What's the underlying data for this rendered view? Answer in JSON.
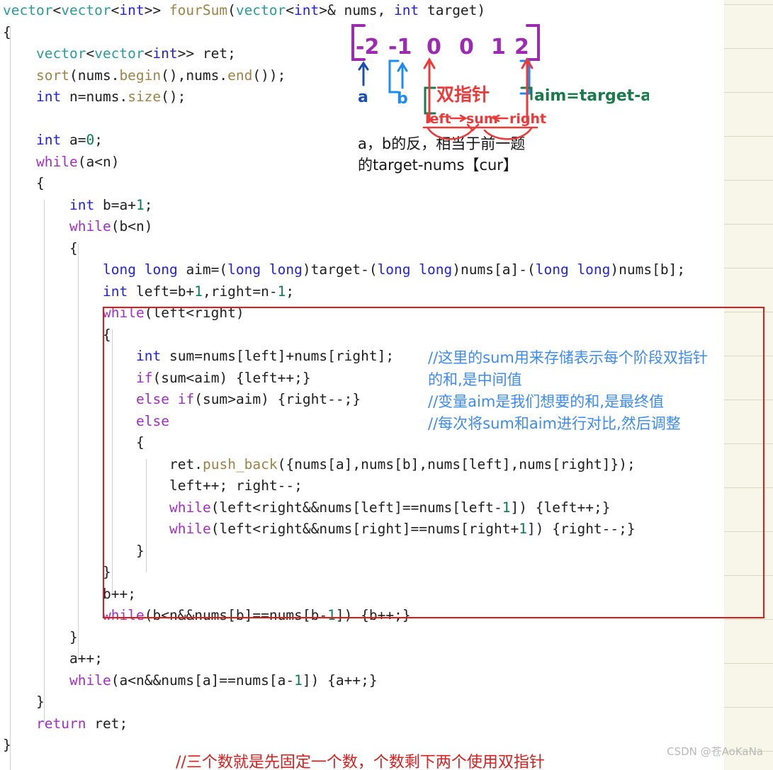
{
  "editor": {
    "language": "cpp",
    "code_lines": [
      "vector<vector<int>> fourSum(vector<int>& nums, int target)",
      "{",
      "    vector<vector<int>> ret;",
      "    sort(nums.begin(),nums.end());",
      "    int n=nums.size();",
      "",
      "    int a=0;",
      "    while(a<n)",
      "    {",
      "        int b=a+1;",
      "        while(b<n)",
      "        {",
      "            long long aim=(long long)target-(long long)nums[a]-(long long)nums[b];",
      "            int left=b+1,right=n-1;",
      "            while(left<right)",
      "            {",
      "                int sum=nums[left]+nums[right];",
      "                if(sum<aim) {left++;}",
      "                else if(sum>aim) {right--;}",
      "                else",
      "                {",
      "                    ret.push_back({nums[a],nums[b],nums[left],nums[right]});",
      "                    left++; right--;",
      "                    while(left<right&&nums[left]==nums[left-1]) {left++;}",
      "                    while(left<right&&nums[right]==nums[right+1]) {right--;}",
      "                }",
      "            }",
      "            b++;",
      "            while(b<n&&nums[b]==nums[b-1]) {b++;}",
      "        }",
      "        a++;",
      "        while(a<n&&nums[a]==nums[a-1]) {a++;}",
      "    }",
      "    return ret;",
      "}"
    ]
  },
  "annotations": {
    "black_note": {
      "line1": "a，b的反，相当于前一题",
      "line2": "的target-nums【cur】"
    },
    "blue_comments": [
      "//这里的sum用来存储表示每个阶段双指针",
      "的和,是中间值",
      "//变量aim是我们想要的和,是最终值",
      "//每次将sum和aim进行对比,然后调整"
    ],
    "red_note_bottom": "//三个数就是先固定一个数，个数剩下两个使用双指针",
    "handwritten": {
      "array_values": [
        "-2",
        "-1",
        "0",
        "0",
        "1",
        "2"
      ],
      "label_a": "a",
      "label_b": "b",
      "label_double_pointer": "双指针",
      "label_left": "left",
      "label_sum": "sum",
      "label_right": "right",
      "label_aim": "aim=target-a-b",
      "colors": {
        "array_bracket": "#9b2bb0",
        "pointer_a": "#1a4fb0",
        "pointer_b": "#1e8bf0",
        "double_pointer_red": "#ea3a3a",
        "aim_green": "#1a7a4a"
      }
    }
  },
  "red_highlight_box": {
    "color": "#e01b1b",
    "label": "highlighted two-pointer block"
  },
  "watermark": {
    "text": "CSDN @苍AoKaNa"
  },
  "paper_panel": {
    "color": "#f8f6e8",
    "rule_color": "#d8d6c4"
  }
}
